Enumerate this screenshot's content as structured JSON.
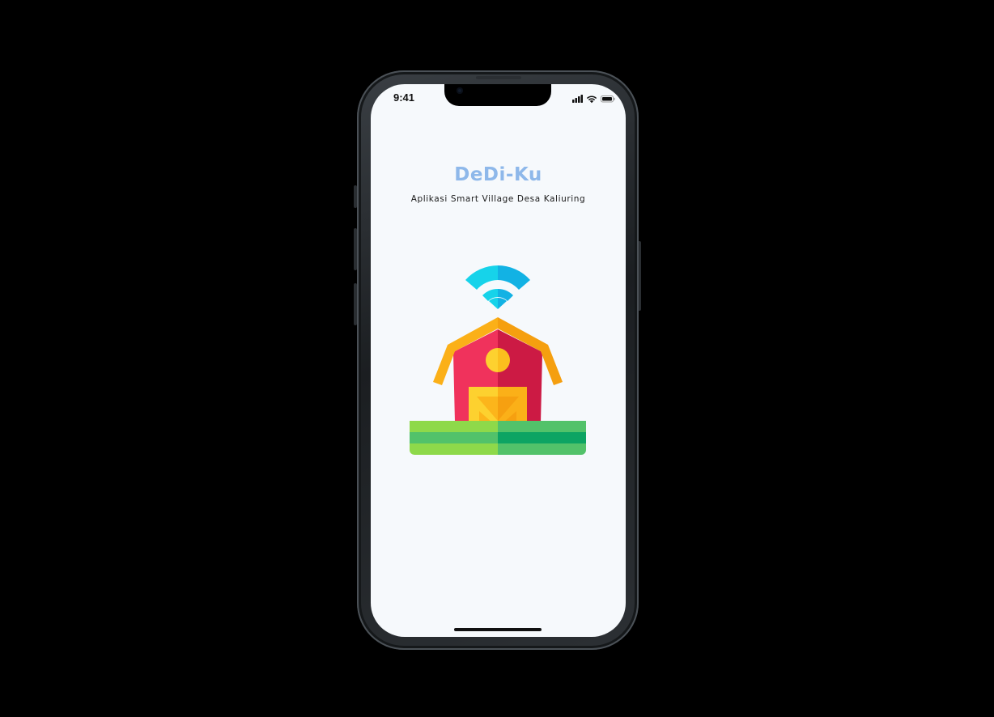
{
  "status_bar": {
    "time": "9:41",
    "icons": [
      "cellular-signal-icon",
      "wifi-icon",
      "battery-icon"
    ]
  },
  "splash": {
    "title": "DeDi-Ku",
    "subtitle": "Aplikasi Smart Village Desa Kaliuring",
    "illustration": "smart-village-barn-wifi-icon"
  },
  "colors": {
    "background": "#000000",
    "screen": "#f6f9fc",
    "title": "#8eb8ea",
    "barn_red_light": "#f0325c",
    "barn_red_dark": "#cc1a44",
    "roof_yellow": "#fbb018",
    "wifi_cyan": "#16d3ea",
    "wifi_blue": "#12b2e4",
    "grass_light": "#8ed94a",
    "grass_dark": "#0da463"
  }
}
